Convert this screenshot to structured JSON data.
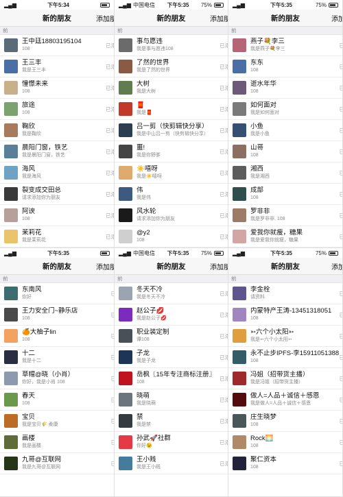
{
  "panels": [
    {
      "status": {
        "carrier": "",
        "time": "下午5:34",
        "battery": ""
      },
      "title": "新的朋友",
      "add_label": "添加朋",
      "section": "前",
      "contacts": [
        {
          "name": "王中廷18803195104",
          "sub": "108",
          "color": "#5a6b7a"
        },
        {
          "name": "王三丰",
          "sub": "我是王三丰",
          "color": "#4a6fa5"
        },
        {
          "name": "憧憬未来",
          "sub": "108",
          "color": "#c9b08a"
        },
        {
          "name": "旅途",
          "sub": "108",
          "color": "#7aa36d"
        },
        {
          "name": "鞠欣",
          "sub": "我是鞠欣",
          "color": "#a77b5c"
        },
        {
          "name": "晨阳门窗，铁艺",
          "sub": "我是晨阳门窗，铁艺",
          "color": "#5a7f99"
        },
        {
          "name": "海风",
          "sub": "我是海风",
          "color": "#6fa3c4"
        },
        {
          "name": "裂变成交田总",
          "sub": "请求添加你为朋友",
          "color": "#3a3a3a"
        },
        {
          "name": "阿谀",
          "sub": "108",
          "color": "#b7a09a"
        },
        {
          "name": "茉莉花",
          "sub": "我是茉莉花",
          "color": "#e9c46a"
        }
      ],
      "added_label": "已添"
    },
    {
      "status": {
        "carrier": "中国电信",
        "time": "下午5:35",
        "battery": "75%"
      },
      "title": "新的朋友",
      "add_label": "添加朋",
      "section": "前",
      "contacts": [
        {
          "name": "事与愿违",
          "sub": "我是事与愿违108",
          "color": "#6b6b6b"
        },
        {
          "name": "了然的世界",
          "sub": "我是了然的世界",
          "color": "#8a5a44"
        },
        {
          "name": "大树",
          "sub": "我是大树",
          "color": "#5f7d4e"
        },
        {
          "name": "🧧",
          "sub": "我是🧧",
          "color": "#c0392b"
        },
        {
          "name": "吕一剪（快剪辑快分享）",
          "sub": "我是中山吕一剪（快剪辑快分享）",
          "color": "#2c3e50"
        },
        {
          "name": "噩!",
          "sub": "我是你野爹",
          "color": "#444444"
        },
        {
          "name": "☀️嘻呀",
          "sub": "我是☀️嘻呀",
          "color": "#e0a96d"
        },
        {
          "name": "伟",
          "sub": "我是伟",
          "color": "#3d5a80"
        },
        {
          "name": "风水轮",
          "sub": "请求添加你为朋友",
          "color": "#1a1a1a"
        },
        {
          "name": "@y2",
          "sub": "108",
          "color": "#cfcfcf"
        }
      ],
      "added_label": "已添"
    },
    {
      "status": {
        "carrier": "",
        "time": "下午5:35",
        "battery": "75%"
      },
      "title": "新的朋友",
      "add_label": "添加",
      "section": "前",
      "contacts": [
        {
          "name": "燕子💐李三",
          "sub": "我是燕子💐李三",
          "color": "#b56576"
        },
        {
          "name": "东东",
          "sub": "108",
          "color": "#4a6fa5"
        },
        {
          "name": "逝水年华",
          "sub": "108",
          "color": "#6d597a"
        },
        {
          "name": "如何面对",
          "sub": "我是如何面对",
          "color": "#7a7a7a"
        },
        {
          "name": "小鱼",
          "sub": "我是小鱼",
          "color": "#355070"
        },
        {
          "name": "山哥",
          "sub": "108",
          "color": "#8d6e63"
        },
        {
          "name": "湘西",
          "sub": "我是湘西",
          "color": "#5c5c5c"
        },
        {
          "name": "成部",
          "sub": "108",
          "color": "#2f4f4f"
        },
        {
          "name": "罗非非",
          "sub": "我是罗非非, 108",
          "color": "#9e7b66"
        },
        {
          "name": "爱我你就瘦，糖果",
          "sub": "我是爱我你就瘦，糖果",
          "color": "#d4a5a5"
        }
      ],
      "added_label": "已"
    },
    {
      "status": {
        "carrier": "",
        "time": "下午5:35",
        "battery": ""
      },
      "title": "新的朋友",
      "add_label": "添加朋",
      "section": "前",
      "contacts": [
        {
          "name": "东南风",
          "sub": "你好",
          "color": "#3c6e71"
        },
        {
          "name": "王力安全门~静乐店",
          "sub": "108",
          "color": "#4a4a4a"
        },
        {
          "name": "🍊大柚子lin",
          "sub": "108",
          "color": "#f4a261"
        },
        {
          "name": "十二",
          "sub": "我是十二",
          "color": "#2b2d42"
        },
        {
          "name": "草帽@晓（小肖）",
          "sub": "你好，我是小肖 108",
          "color": "#8d99ae"
        },
        {
          "name": "春天",
          "sub": "108",
          "color": "#6a994e"
        },
        {
          "name": "宝贝",
          "sub": "我是宝贝🌾 柔康",
          "color": "#bc6c25"
        },
        {
          "name": "画楼",
          "sub": "我是画楼",
          "color": "#606c38"
        },
        {
          "name": "九哥@互联网",
          "sub": "我是九哥@互联网",
          "color": "#283618"
        }
      ],
      "added_label": "已"
    },
    {
      "status": {
        "carrier": "中国电信",
        "time": "下午5:35",
        "battery": "75%"
      },
      "title": "新的朋友",
      "add_label": "添加朋",
      "section": "前",
      "contacts": [
        {
          "name": "冬天不冷",
          "sub": "我是冬天不冷",
          "color": "#9aa5b1"
        },
        {
          "name": "赵公子💋",
          "sub": "我是赵公子💋",
          "color": "#7b2cbf"
        },
        {
          "name": "职业装定制",
          "sub": "谭108",
          "color": "#495057"
        },
        {
          "name": "子龙",
          "sub": "我是子龙",
          "color": "#1d3557"
        },
        {
          "name": "岳枫〖15年专注商标注册〗",
          "sub": "108",
          "color": "#c1121f"
        },
        {
          "name": "晓萌",
          "sub": "我是晓萌",
          "color": "#6c757d"
        },
        {
          "name": "禁",
          "sub": "我是禁",
          "color": "#343a40"
        },
        {
          "name": "孙武🚀社群",
          "sub": "你好😉",
          "color": "#e63946"
        },
        {
          "name": "王小贱",
          "sub": "我是王小贱",
          "color": "#457b9d"
        }
      ],
      "added_label": "已添"
    },
    {
      "status": {
        "carrier": "",
        "time": "下午5:35",
        "battery": "75%"
      },
      "title": "新的朋友",
      "add_label": "添加",
      "section": "前",
      "contacts": [
        {
          "name": "李金栓",
          "sub": "请资料",
          "color": "#5e548e"
        },
        {
          "name": "内蒙特产王涛-13451318051",
          "sub": "108",
          "color": "#9f86c0"
        },
        {
          "name": "➳六个小太阳➳",
          "sub": "我是➳六个小太阳➳",
          "color": "#e09f3e"
        },
        {
          "name": "永不止步IPFS-李15911051388",
          "sub": "108",
          "color": "#335c67"
        },
        {
          "name": "冯姐（招带货主播）",
          "sub": "我是冯姐（招带货主播）",
          "color": "#9e2a2b"
        },
        {
          "name": "做人=人品＋诚信＋感恩",
          "sub": "我是做人=人品＋诚信＋感恩",
          "color": "#540b0e"
        },
        {
          "name": "庄生晓梦",
          "sub": "108",
          "color": "#4a5759"
        },
        {
          "name": "Rock🌅",
          "sub": "108",
          "color": "#b08968"
        },
        {
          "name": "聚仁资本",
          "sub": "108",
          "color": "#22223b"
        }
      ],
      "added_label": "已"
    }
  ]
}
